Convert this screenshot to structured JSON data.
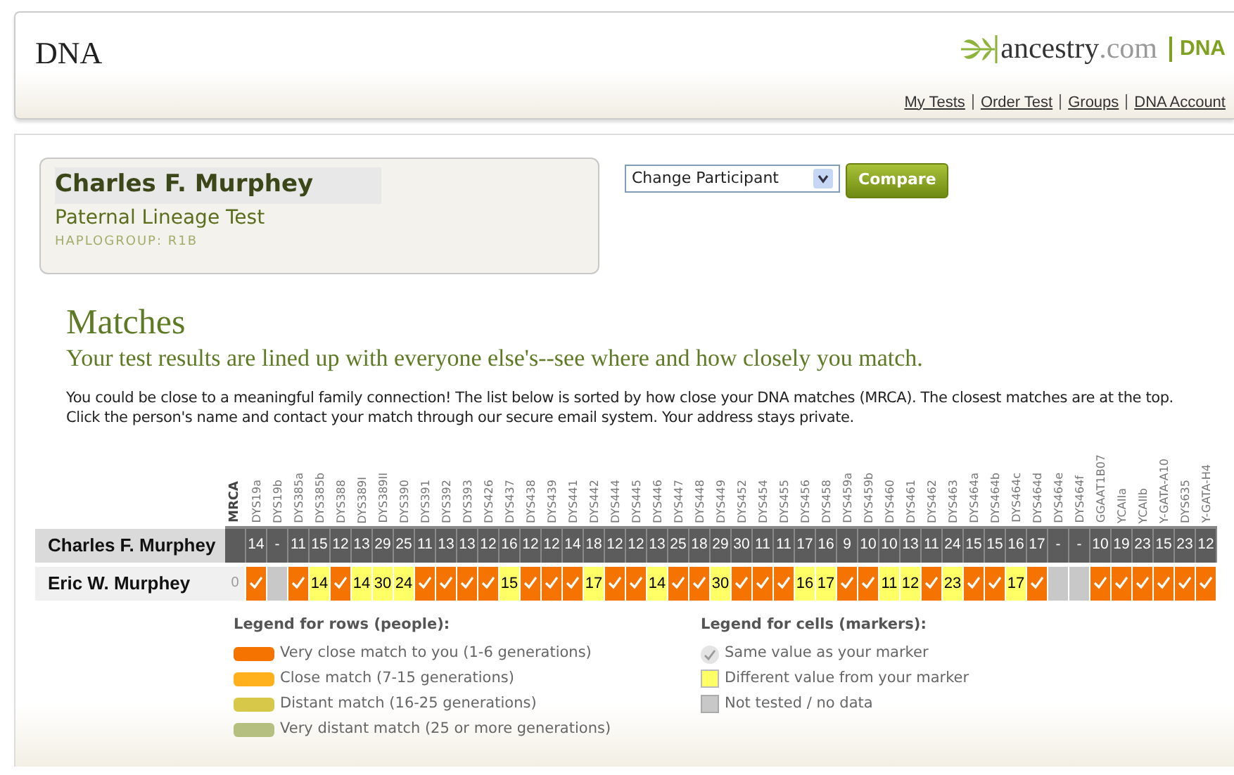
{
  "header": {
    "title": "DNA",
    "logo": {
      "brand": "ancestry",
      "domain": ".com",
      "product": "DNA"
    },
    "links": [
      "My Tests",
      "Order Test",
      "Groups",
      "DNA Account"
    ]
  },
  "participant": {
    "name": "Charles F. Murphey",
    "test": "Paternal Lineage Test",
    "haplogroup": "HAPLOGROUP: R1B"
  },
  "participant_select": {
    "value": "Change Participant"
  },
  "compare_button": "Compare",
  "matches": {
    "title": "Matches",
    "subtitle": "Your test results are lined up with everyone else's--see where and how closely you match.",
    "description": "You could be close to a meaningful family connection! The list below is sorted by how close your DNA matches (MRCA). The closest matches are at the top. Click the person's name and contact your match through our secure email system. Your address stays private."
  },
  "table": {
    "mrca_label": "MRCA",
    "markers": [
      "DYS19a",
      "DYS19b",
      "DYS385a",
      "DYS385b",
      "DYS388",
      "DYS389I",
      "DYS389II",
      "DYS390",
      "DYS391",
      "DYS392",
      "DYS393",
      "DYS426",
      "DYS437",
      "DYS438",
      "DYS439",
      "DYS441",
      "DYS442",
      "DYS444",
      "DYS445",
      "DYS446",
      "DYS447",
      "DYS448",
      "DYS449",
      "DYS452",
      "DYS454",
      "DYS455",
      "DYS456",
      "DYS458",
      "DYS459a",
      "DYS459b",
      "DYS460",
      "DYS461",
      "DYS462",
      "DYS463",
      "DYS464a",
      "DYS464b",
      "DYS464c",
      "DYS464d",
      "DYS464e",
      "DYS464f",
      "GGAAT1B07",
      "YCAIIa",
      "YCAIIb",
      "Y-GATA-A10",
      "DYS635",
      "Y-GATA-H4"
    ],
    "reference": {
      "name": "Charles F. Murphey",
      "values": [
        "14",
        "-",
        "11",
        "15",
        "12",
        "13",
        "29",
        "25",
        "11",
        "13",
        "13",
        "12",
        "16",
        "12",
        "12",
        "14",
        "18",
        "12",
        "12",
        "13",
        "25",
        "18",
        "29",
        "30",
        "11",
        "11",
        "17",
        "16",
        "9",
        "10",
        "10",
        "13",
        "11",
        "24",
        "15",
        "15",
        "16",
        "17",
        "-",
        "-",
        "10",
        "19",
        "23",
        "15",
        "23",
        "12"
      ]
    },
    "matches": [
      {
        "name": "Eric W. Murphey",
        "mrca": "0",
        "color": "#f57300",
        "cells": [
          {
            "kind": "same"
          },
          {
            "kind": "none"
          },
          {
            "kind": "same"
          },
          {
            "kind": "diff",
            "value": "14"
          },
          {
            "kind": "same"
          },
          {
            "kind": "diff",
            "value": "14"
          },
          {
            "kind": "diff",
            "value": "30"
          },
          {
            "kind": "diff",
            "value": "24"
          },
          {
            "kind": "same"
          },
          {
            "kind": "same"
          },
          {
            "kind": "same"
          },
          {
            "kind": "same"
          },
          {
            "kind": "diff",
            "value": "15"
          },
          {
            "kind": "same"
          },
          {
            "kind": "same"
          },
          {
            "kind": "same"
          },
          {
            "kind": "diff",
            "value": "17"
          },
          {
            "kind": "same"
          },
          {
            "kind": "same"
          },
          {
            "kind": "diff",
            "value": "14"
          },
          {
            "kind": "same"
          },
          {
            "kind": "same"
          },
          {
            "kind": "diff",
            "value": "30"
          },
          {
            "kind": "same"
          },
          {
            "kind": "same"
          },
          {
            "kind": "same"
          },
          {
            "kind": "diff",
            "value": "16"
          },
          {
            "kind": "diff",
            "value": "17"
          },
          {
            "kind": "same"
          },
          {
            "kind": "same"
          },
          {
            "kind": "diff",
            "value": "11"
          },
          {
            "kind": "diff",
            "value": "12"
          },
          {
            "kind": "same"
          },
          {
            "kind": "diff",
            "value": "23"
          },
          {
            "kind": "same"
          },
          {
            "kind": "same"
          },
          {
            "kind": "diff",
            "value": "17"
          },
          {
            "kind": "same"
          },
          {
            "kind": "none"
          },
          {
            "kind": "none"
          },
          {
            "kind": "same"
          },
          {
            "kind": "same"
          },
          {
            "kind": "same"
          },
          {
            "kind": "same"
          },
          {
            "kind": "same"
          },
          {
            "kind": "same"
          }
        ]
      }
    ]
  },
  "legend_rows": {
    "title": "Legend for rows (people):",
    "items": [
      {
        "label": "Very close match to you (1-6 generations)",
        "color": "#f57300"
      },
      {
        "label": "Close match (7-15 generations)",
        "color": "#ffb01c"
      },
      {
        "label": "Distant match (16-25 generations)",
        "color": "#d8c84a"
      },
      {
        "label": "Very distant match (25 or more generations)",
        "color": "#b4bf80"
      }
    ]
  },
  "legend_cells": {
    "title": "Legend for cells (markers):",
    "items": [
      {
        "kind": "same",
        "label": "Same value as your marker"
      },
      {
        "kind": "diff",
        "label": "Different value from your marker"
      },
      {
        "kind": "none",
        "label": "Not tested / no data"
      }
    ]
  }
}
